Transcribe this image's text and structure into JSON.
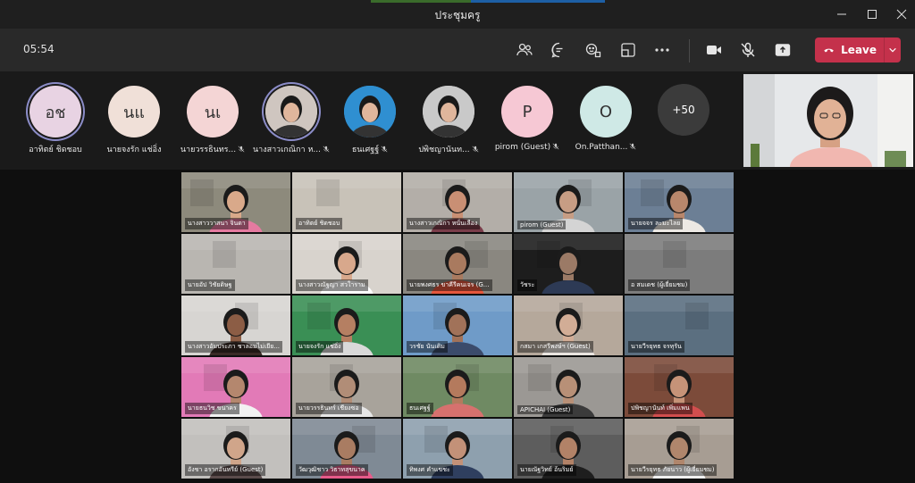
{
  "window": {
    "title": "ประชุมครู"
  },
  "toolbar": {
    "timer": "05:54",
    "leave_label": "Leave"
  },
  "strip": {
    "participants": [
      {
        "initials": "อช",
        "name": "อาทิตย์ ชิดชอบ",
        "bg": "#e8d3e3"
      },
      {
        "initials": "นแ",
        "name": "นายจงรัก แช่อิ่ง",
        "bg": "#f0e0d8"
      },
      {
        "initials": "นเ",
        "name": "นายวรรธินทร...",
        "bg": "#f4d5d5"
      },
      {
        "initials": "",
        "name": "นางสาวเกณิกา ห...",
        "bg": "#cfc6c0"
      },
      {
        "initials": "",
        "name": "ธนเศฐฐ์",
        "bg": "#2f8fd1"
      },
      {
        "initials": "",
        "name": "ปพิชญานันท...",
        "bg": "#c9c9c9"
      },
      {
        "initials": "P",
        "name": "pirom (Guest)",
        "bg": "#f6c8d4"
      },
      {
        "initials": "O",
        "name": "On.Patthan...",
        "bg": "#cfe9e6"
      }
    ],
    "more_count": "+50"
  },
  "grid": {
    "tiles": [
      {
        "name": "นางสาววาสนา จินดา",
        "bg": "#8d8a7c",
        "skin": "#d9a98a",
        "shirt": "#e57aa0"
      },
      {
        "name": "อาทิตย์ ชิดชอบ",
        "bg": "#c8c2b8",
        "skin": "",
        "shirt": ""
      },
      {
        "name": "นางสาวเกณิกา หนั่นเลือง",
        "bg": "#b3aea8",
        "skin": "#c98f74",
        "shirt": "#7a3d4a"
      },
      {
        "name": "pirom (Guest)",
        "bg": "#9aa3a7",
        "skin": "#c79d84",
        "shirt": "#d4d4d4"
      },
      {
        "name": "นายจจร ละมะไลย",
        "bg": "#6c7f95",
        "skin": "#b8876c",
        "shirt": "#ede9e4"
      },
      {
        "name": "นายอัป วิชัยดิษฐ",
        "bg": "#b9b6b1",
        "skin": "",
        "shirt": ""
      },
      {
        "name": "นางสาวณัฐญา สวใาราม",
        "bg": "#d8d3cd",
        "skin": "#d8a88c",
        "shirt": "#ffffff"
      },
      {
        "name": "นายพงศธร ขาคีรีคนเจร (G...",
        "bg": "#8a8780",
        "skin": "#a97a5f",
        "shirt": "#e5573c"
      },
      {
        "name": "วัชระ",
        "bg": "#1d1d1d",
        "skin": "#9b7a66",
        "shirt": "#2d3a55"
      },
      {
        "name": "อ สมเดช (ผู้เยี่ยมชม)",
        "bg": "#7c7c7c",
        "skin": "",
        "shirt": ""
      },
      {
        "name": "นางสาวอัมประภา ชาลอมไม่เยีย...",
        "bg": "#d7d5d2",
        "skin": "#8c5d45",
        "shirt": "#3a2a26"
      },
      {
        "name": "นายจงรัก แช่อิ่ง",
        "bg": "#3a8f55",
        "skin": "#b57f62",
        "shirt": "#d9d9d9"
      },
      {
        "name": "วรชัย นันเดิม",
        "bg": "#6f9bc8",
        "skin": "#a17259",
        "shirt": "#3b4b6b"
      },
      {
        "name": "กสมา เกสรีพงษ์ฯ (Guest)",
        "bg": "#b5a89b",
        "skin": "#d2ad96",
        "shirt": "#e9e4df"
      },
      {
        "name": "นายวีรยุทธ จรทุรัน",
        "bg": "#5b6f80",
        "skin": "",
        "shirt": ""
      },
      {
        "name": "นายธนวิช ขนาคร",
        "bg": "#e27ab7",
        "skin": "#b4876e",
        "shirt": "#f2f2f2"
      },
      {
        "name": "นายวรรธินทร์ เชียงซอ",
        "bg": "#a8a39b",
        "skin": "#b18d77",
        "shirt": "#e6e6e6"
      },
      {
        "name": "ธนเศฐฐ์",
        "bg": "#6f8a63",
        "skin": "#b47a5d",
        "shirt": "#d6716e"
      },
      {
        "name": "APICHAI (Guest)",
        "bg": "#9b9894",
        "skin": "#b89077",
        "shirt": "#3b3b3b"
      },
      {
        "name": "ปพิชญานันท์ เพิ่มแพน",
        "bg": "#7c4b3a",
        "skin": "#c69378",
        "shirt": "#d14e4e"
      },
      {
        "name": "อังชา อรากอันทรีย์ (Guest)",
        "bg": "#c2c0bd",
        "skin": "#d0a58a",
        "shirt": "#5c4c4c"
      },
      {
        "name": "วัฒวุฒิชาว วิธาทสุขนาค",
        "bg": "#7f8a95",
        "skin": "#a97c62",
        "shirt": "#e85b8a"
      },
      {
        "name": "ทิพงศ คำแขชะ",
        "bg": "#8ea0ae",
        "skin": "#c39178",
        "shirt": "#2f3f5f"
      },
      {
        "name": "นายณัฐวิทย์ อ้นริมย์",
        "bg": "#5d5d5d",
        "skin": "#b28267",
        "shirt": "#1e1e1e"
      },
      {
        "name": "นายวีรยุทธ ภัยนาว (ผู้เยี่ยมชม)",
        "bg": "#a79d93",
        "skin": "#b0866c",
        "shirt": "#f0f0f0"
      }
    ]
  }
}
